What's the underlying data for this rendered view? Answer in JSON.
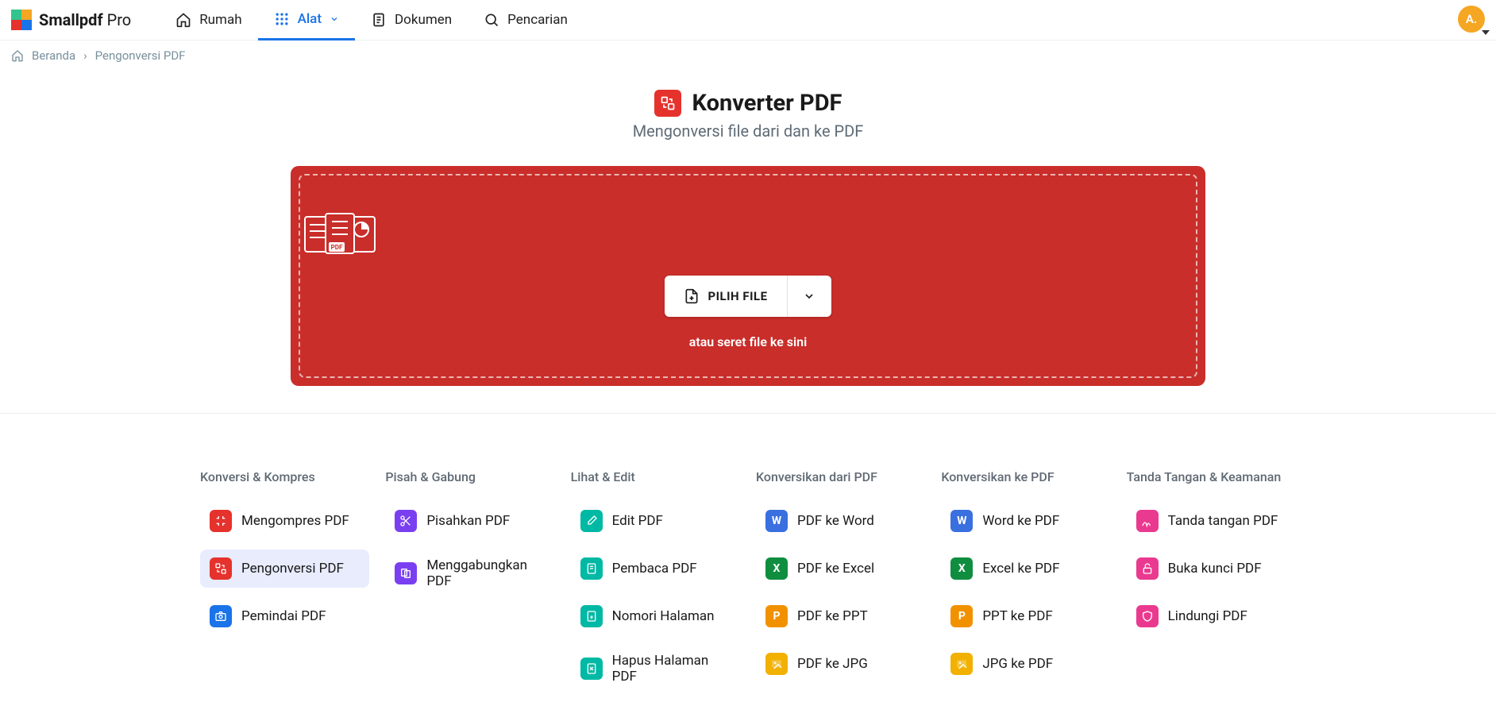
{
  "brand": {
    "name": "Smallpdf",
    "suffix": "Pro"
  },
  "nav": {
    "home": "Rumah",
    "tools": "Alat",
    "documents": "Dokumen",
    "search": "Pencarian"
  },
  "avatar": "A.",
  "breadcrumb": {
    "home": "Beranda",
    "current": "Pengonversi PDF"
  },
  "hero": {
    "title": "Konverter PDF",
    "subtitle": "Mengonversi file dari dan ke PDF",
    "choose_file": "PILIH FILE",
    "drop_hint": "atau seret file ke sini"
  },
  "columns": [
    {
      "title": "Konversi & Kompres",
      "tools": [
        {
          "label": "Mengompres PDF",
          "color": "#e5322d",
          "icon": "compress",
          "selected": false
        },
        {
          "label": "Pengonversi PDF",
          "color": "#e5322d",
          "icon": "convert",
          "selected": true
        },
        {
          "label": "Pemindai PDF",
          "color": "#1a73e8",
          "icon": "camera",
          "selected": false
        }
      ]
    },
    {
      "title": "Pisah & Gabung",
      "tools": [
        {
          "label": "Pisahkan PDF",
          "color": "#7b3ff2",
          "icon": "scissors"
        },
        {
          "label": "Menggabungkan PDF",
          "color": "#7b3ff2",
          "icon": "merge"
        }
      ]
    },
    {
      "title": "Lihat & Edit",
      "tools": [
        {
          "label": "Edit PDF",
          "color": "#00b9a4",
          "icon": "edit"
        },
        {
          "label": "Pembaca PDF",
          "color": "#00b9a4",
          "icon": "reader"
        },
        {
          "label": "Nomori Halaman",
          "color": "#00b9a4",
          "icon": "number"
        },
        {
          "label": "Hapus Halaman PDF",
          "color": "#00b9a4",
          "icon": "delete"
        }
      ]
    },
    {
      "title": "Konversikan dari PDF",
      "tools": [
        {
          "label": "PDF ke Word",
          "color": "#3a6fe0",
          "icon": "W"
        },
        {
          "label": "PDF ke Excel",
          "color": "#0f8e3f",
          "icon": "X"
        },
        {
          "label": "PDF ke PPT",
          "color": "#f29100",
          "icon": "P"
        },
        {
          "label": "PDF ke JPG",
          "color": "#f2b100",
          "icon": "img"
        }
      ]
    },
    {
      "title": "Konversikan ke PDF",
      "tools": [
        {
          "label": "Word ke PDF",
          "color": "#3a6fe0",
          "icon": "W"
        },
        {
          "label": "Excel ke PDF",
          "color": "#0f8e3f",
          "icon": "X"
        },
        {
          "label": "PPT ke PDF",
          "color": "#f29100",
          "icon": "P"
        },
        {
          "label": "JPG ke PDF",
          "color": "#f2b100",
          "icon": "img"
        }
      ]
    },
    {
      "title": "Tanda Tangan & Keamanan",
      "tools": [
        {
          "label": "Tanda tangan PDF",
          "color": "#ea3a8f",
          "icon": "sign"
        },
        {
          "label": "Buka kunci PDF",
          "color": "#ea3a8f",
          "icon": "unlock"
        },
        {
          "label": "Lindungi PDF",
          "color": "#ea3a8f",
          "icon": "protect"
        }
      ]
    }
  ]
}
